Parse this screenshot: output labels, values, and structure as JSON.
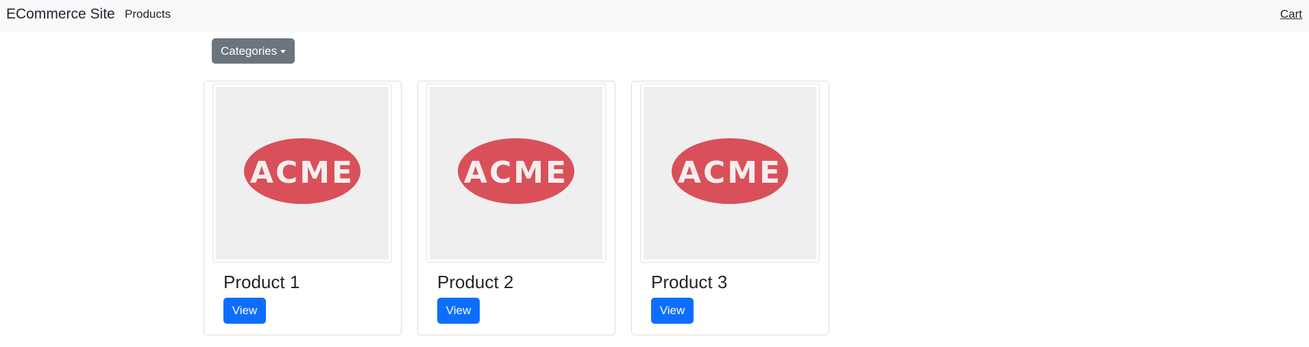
{
  "navbar": {
    "brand": "ECommerce Site",
    "links": [
      {
        "label": "Products"
      }
    ],
    "cart_label": "Cart"
  },
  "categories": {
    "label": "Categories"
  },
  "products": [
    {
      "title": "Product 1",
      "button_label": "View",
      "logo_text": "ACME"
    },
    {
      "title": "Product 2",
      "button_label": "View",
      "logo_text": "ACME"
    },
    {
      "title": "Product 3",
      "button_label": "View",
      "logo_text": "ACME"
    }
  ],
  "colors": {
    "navbar_bg": "#f8f9fa",
    "secondary_button": "#6c757d",
    "primary_button": "#0d6efd",
    "logo_red": "#d9505a",
    "thumb_bg": "#efefef"
  }
}
